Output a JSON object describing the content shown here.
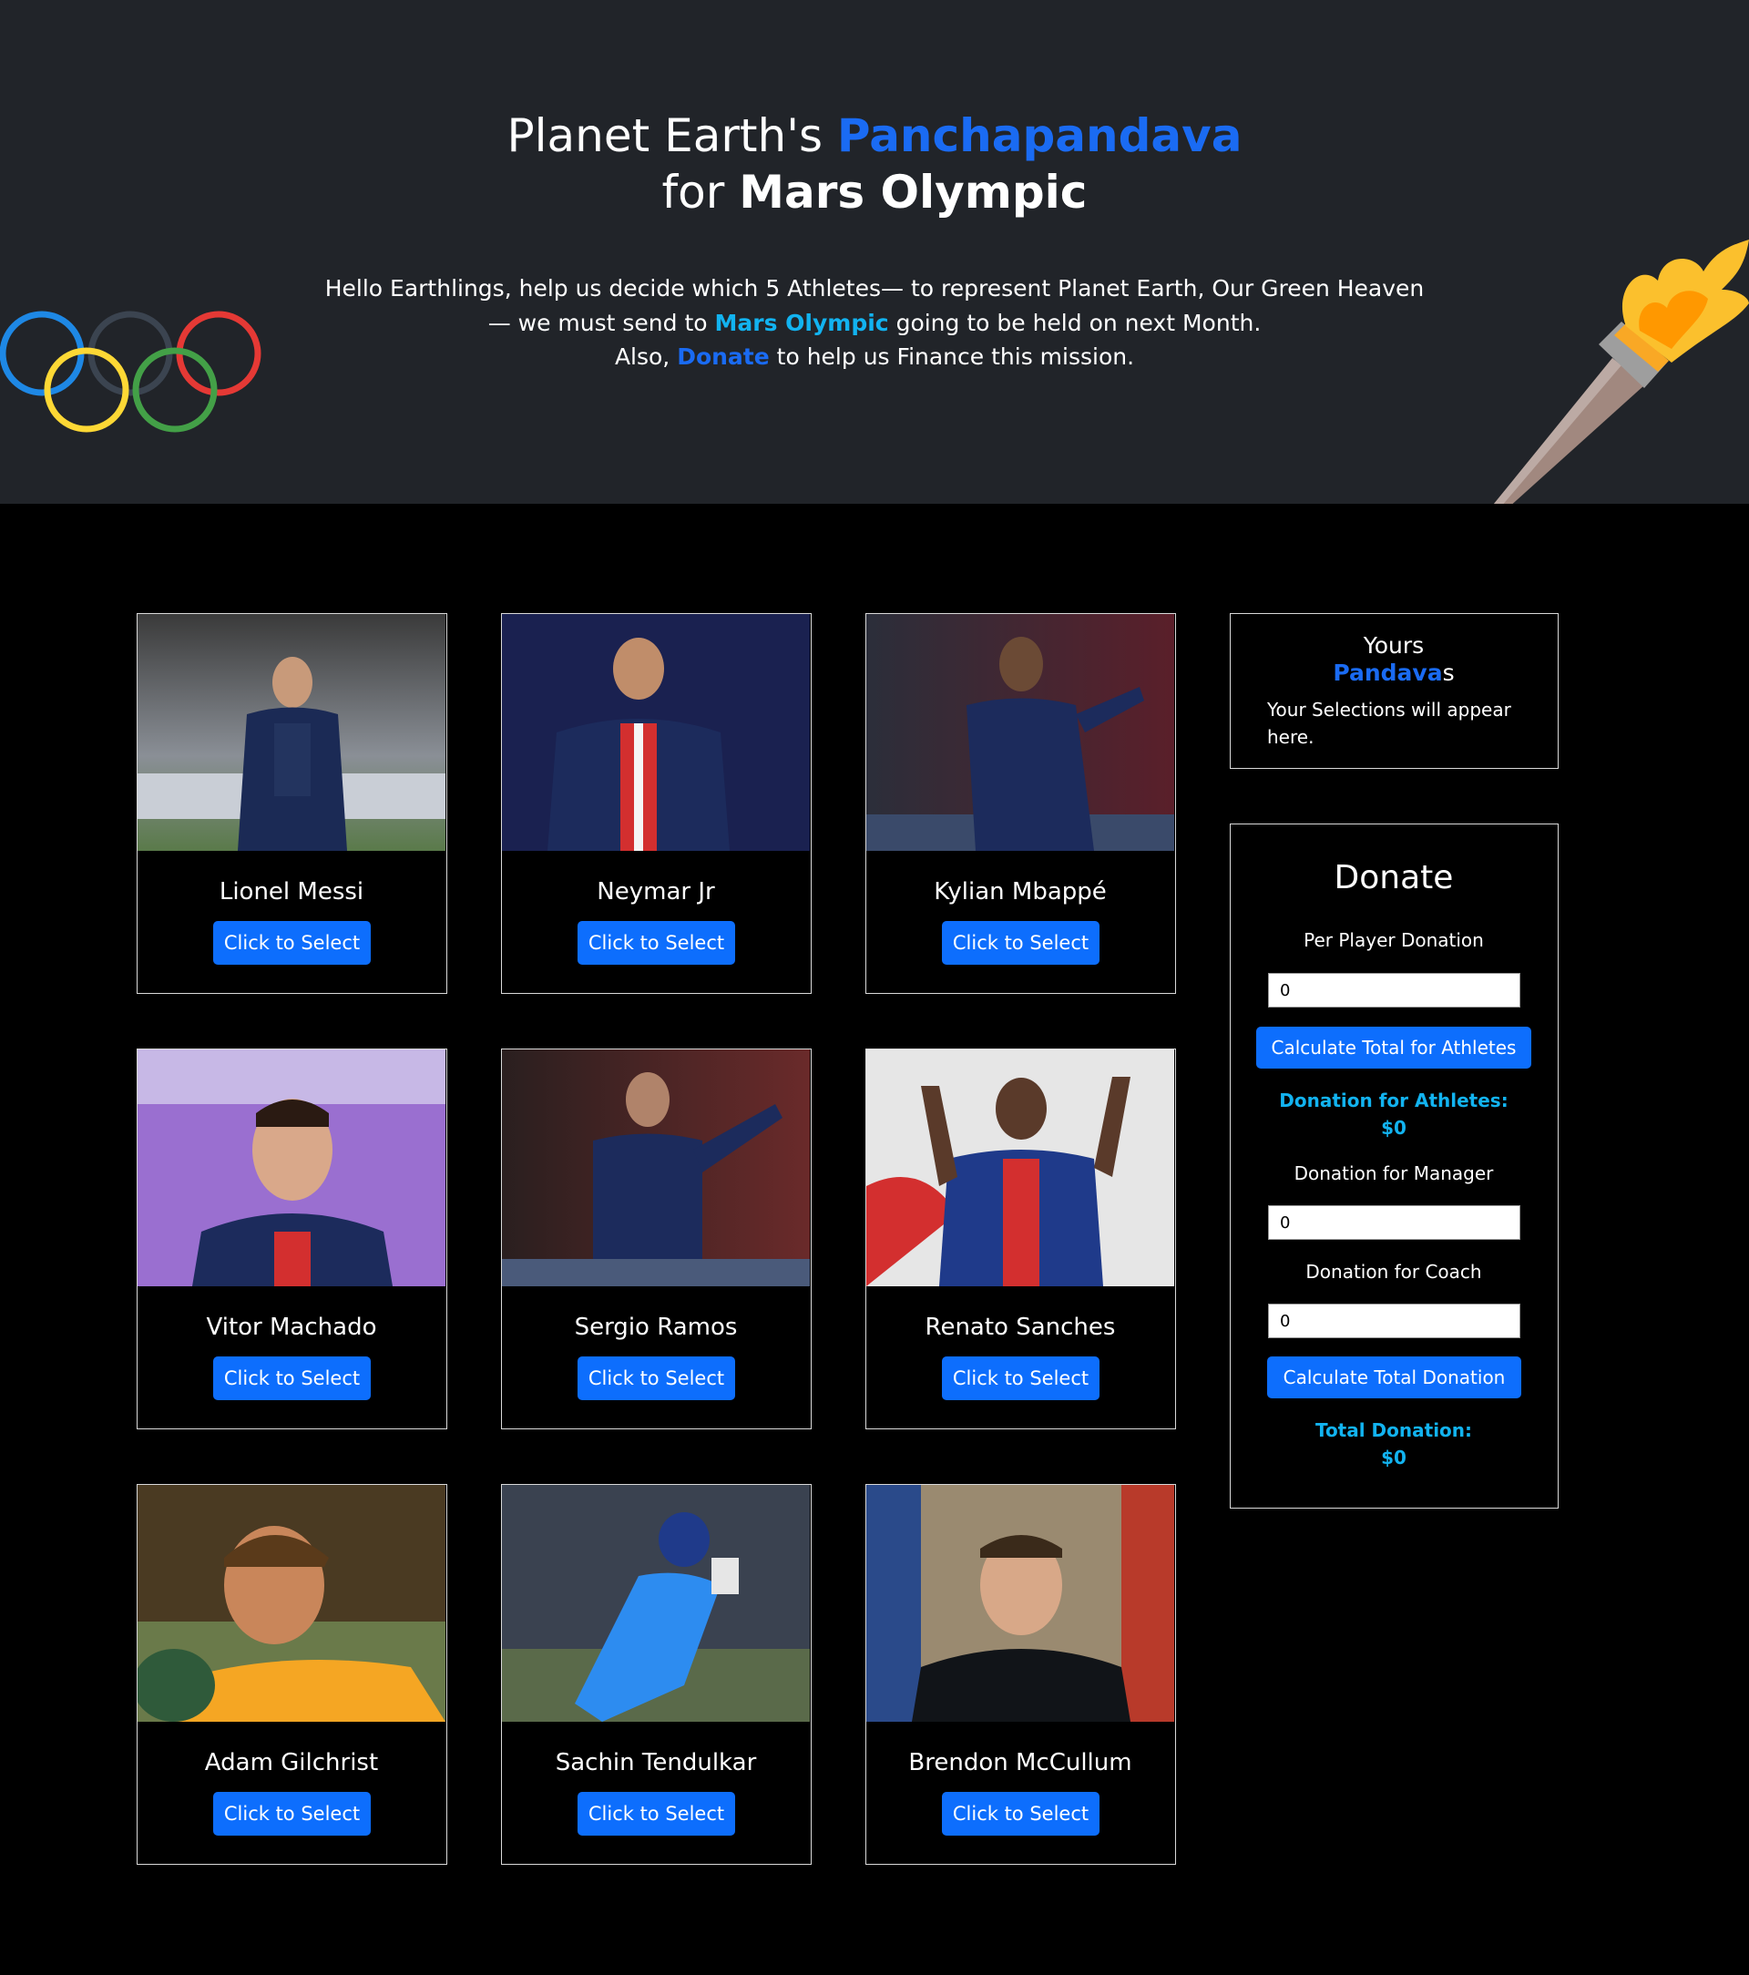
{
  "header": {
    "title_part1": "Planet Earth's ",
    "title_accent": "Panchapandava",
    "title_part2": "for ",
    "title_bold": "Mars Olympic",
    "intro_1": "Hello Earthlings, help us decide which 5 Athletes— to represent Planet Earth, Our Green Heaven",
    "intro_2a": "— we must send to ",
    "intro_2b": "Mars Olympic",
    "intro_2c": " going to be held on next Month.",
    "intro_3a": "Also, ",
    "intro_3b": "Donate",
    "intro_3c": " to help us Finance this mission."
  },
  "colors": {
    "header_bg": "#212429",
    "page_bg": "#000000",
    "button_blue": "#0d6efd",
    "accent_blue": "#1a6bf3",
    "accent_cyan": "#12b3f0"
  },
  "athletes": [
    {
      "name": "Lionel Messi",
      "button": "Click to Select"
    },
    {
      "name": "Neymar Jr",
      "button": "Click to Select"
    },
    {
      "name": "Kylian Mbappé",
      "button": "Click to Select"
    },
    {
      "name": "Vitor Machado",
      "button": "Click to Select"
    },
    {
      "name": "Sergio Ramos",
      "button": "Click to Select"
    },
    {
      "name": "Renato Sanches",
      "button": "Click to Select"
    },
    {
      "name": "Adam Gilchrist",
      "button": "Click to Select"
    },
    {
      "name": "Sachin Tendulkar",
      "button": "Click to Select"
    },
    {
      "name": "Brendon McCullum",
      "button": "Click to Select"
    }
  ],
  "selections": {
    "heading_1": "Yours",
    "heading_accent": "Pandava",
    "heading_suffix": "s",
    "message": "Your Selections will appear here."
  },
  "donate": {
    "title": "Donate",
    "per_player_label": "Per Player Donation",
    "per_player_value": "0",
    "calc_athletes_button": "Calculate Total for Athletes",
    "athletes_result_label": "Donation for Athletes:",
    "athletes_result_value": "$0",
    "manager_label": "Donation for Manager",
    "manager_value": "0",
    "coach_label": "Donation for Coach",
    "coach_value": "0",
    "calc_total_button": "Calculate Total Donation",
    "total_label": "Total Donation:",
    "total_value": "$0"
  }
}
